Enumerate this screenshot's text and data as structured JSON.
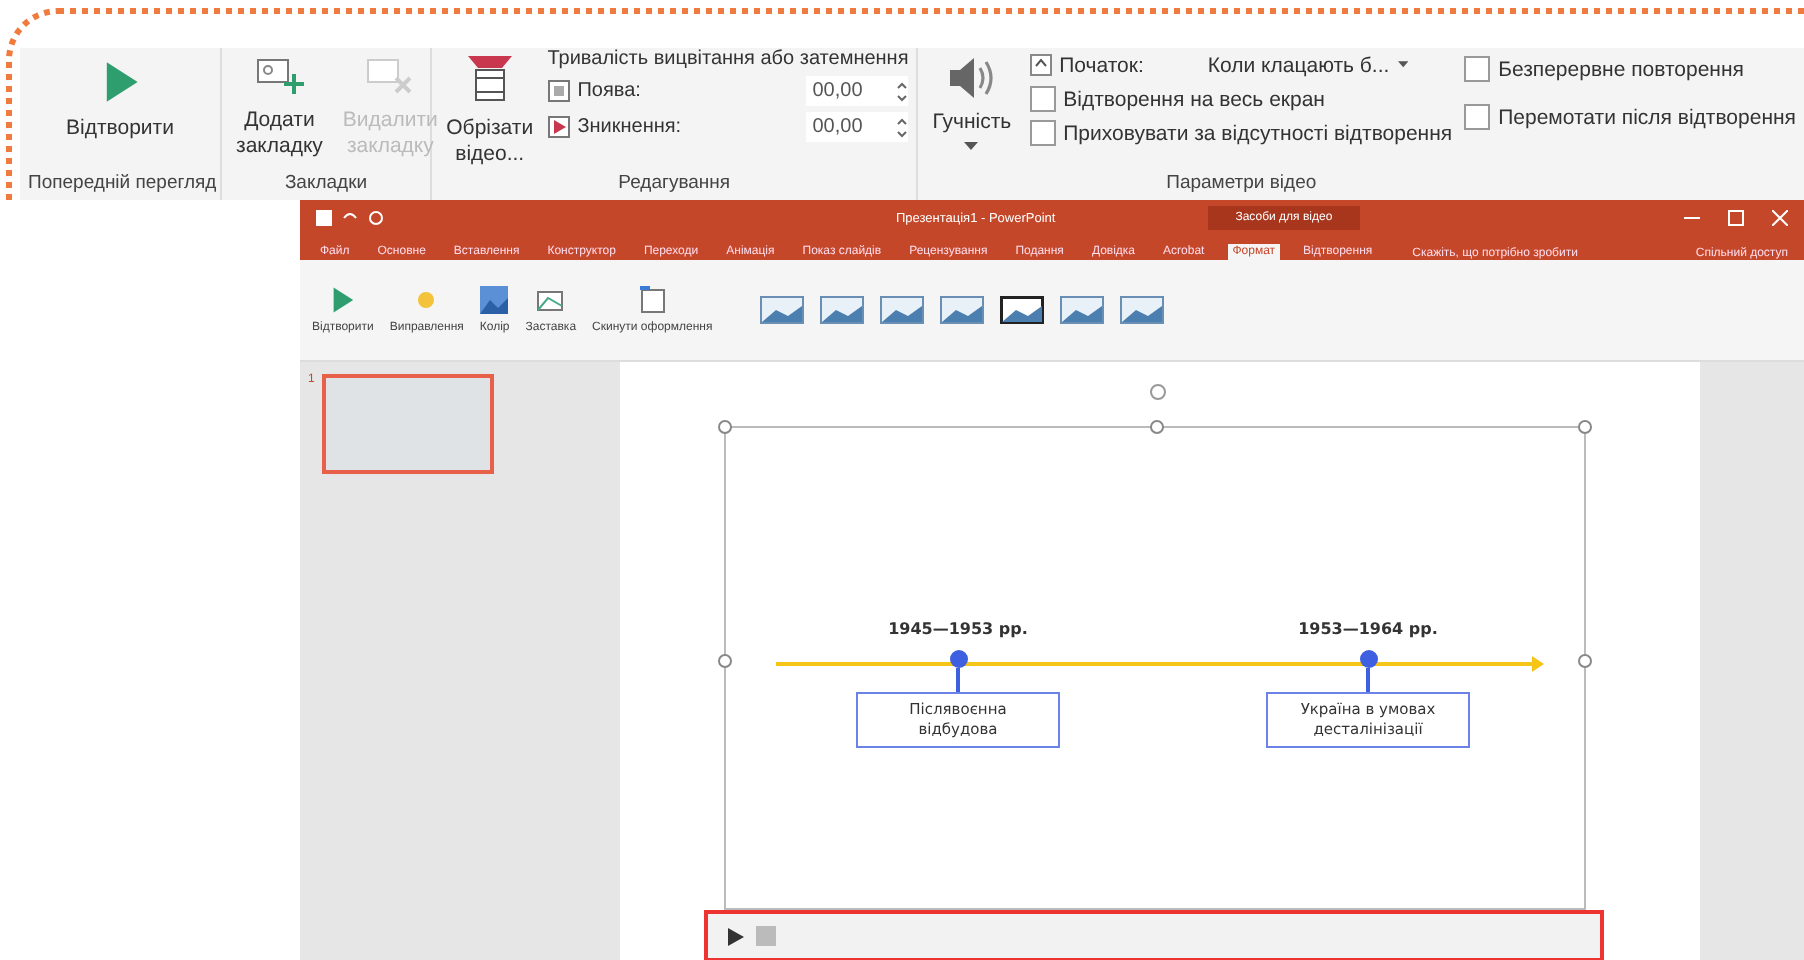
{
  "ribbon": {
    "preview": {
      "play_button": "Відтворити",
      "group_label": "Попередній перегляд"
    },
    "bookmarks": {
      "add_button": {
        "label": "Додати закладку",
        "disabled": false
      },
      "remove_button": {
        "label": "Видалити закладку",
        "disabled": true
      },
      "group_label": "Закладки"
    },
    "editing": {
      "trim_button": "Обрізати відео...",
      "fade_title": "Тривалість вицвітання або затемнення",
      "fade_in": {
        "label": "Поява:",
        "value": "00,00"
      },
      "fade_out": {
        "label": "Зникнення:",
        "value": "00,00"
      },
      "group_label": "Редагування"
    },
    "video_options": {
      "volume_button": "Гучність",
      "start": {
        "label": "Початок:",
        "value": "Коли клацають б..."
      },
      "checkboxes": [
        {
          "label": "Відтворення на весь екран",
          "checked": false
        },
        {
          "label": "Приховувати за відсутності відтворення",
          "checked": false
        },
        {
          "label": "Безперервне повторення",
          "checked": false
        },
        {
          "label": "Перемотати після відтворення",
          "checked": false
        }
      ],
      "group_label": "Параметри відео"
    }
  },
  "window": {
    "title": "Презентація1 - PowerPoint",
    "context_title": "Засоби для відео",
    "tabs": [
      {
        "label": "Файл",
        "selected": false
      },
      {
        "label": "Основне",
        "selected": false
      },
      {
        "label": "Вставлення",
        "selected": false
      },
      {
        "label": "Конструктор",
        "selected": false
      },
      {
        "label": "Переходи",
        "selected": false
      },
      {
        "label": "Анімація",
        "selected": false
      },
      {
        "label": "Показ слайдів",
        "selected": false
      },
      {
        "label": "Рецензування",
        "selected": false
      },
      {
        "label": "Подання",
        "selected": false
      },
      {
        "label": "Довідка",
        "selected": false
      },
      {
        "label": "Acrobat",
        "selected": false
      },
      {
        "label": "Формат",
        "selected": true
      },
      {
        "label": "Відтворення",
        "selected": false
      }
    ],
    "tell_me": "Скажіть, що потрібно зробити",
    "share": "Спільний доступ",
    "mini_ribbon": [
      {
        "label": "Відтворити"
      },
      {
        "label": "Виправлення"
      },
      {
        "label": "Колір"
      },
      {
        "label": "Заставка"
      },
      {
        "label": "Скинути оформлення"
      }
    ],
    "slides": [
      {
        "number": "1",
        "selected": true
      }
    ],
    "timeline": [
      {
        "date": "1945—1953 рр.",
        "label": "Післявоєнна відбудова"
      },
      {
        "date": "1953—1964 рр.",
        "label": "Україна в умовах десталінізації"
      }
    ]
  }
}
